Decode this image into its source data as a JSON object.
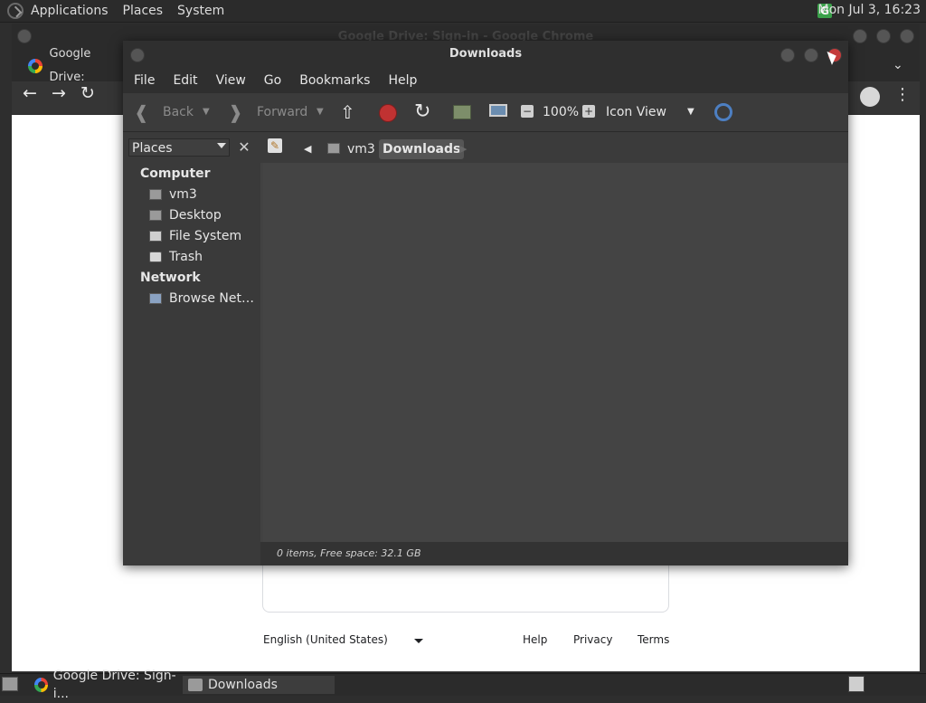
{
  "top_panel": {
    "menus": [
      "Applications",
      "Places",
      "System"
    ],
    "clock": "Mon Jul  3, 16:23"
  },
  "chrome": {
    "title": "Google Drive: Sign-in - Google Chrome",
    "tab_label": "Google Drive:",
    "page": {
      "language": "English (United States)",
      "links": [
        "Help",
        "Privacy",
        "Terms"
      ]
    }
  },
  "file_manager": {
    "title": "Downloads",
    "menu": [
      "File",
      "Edit",
      "View",
      "Go",
      "Bookmarks",
      "Help"
    ],
    "toolbar": {
      "back": "Back",
      "forward": "Forward",
      "zoom": "100%",
      "view_mode": "Icon View"
    },
    "sidebar": {
      "combo": "Places",
      "sections": [
        {
          "heading": "Computer",
          "items": [
            "vm3",
            "Desktop",
            "File System",
            "Trash"
          ]
        },
        {
          "heading": "Network",
          "items": [
            "Browse Net…"
          ]
        }
      ]
    },
    "pathbar": {
      "home": "vm3",
      "current": "Downloads"
    },
    "status": "0 items, Free space: 32.1 GB"
  },
  "taskbar": {
    "tasks": [
      "Google Drive: Sign-i...",
      "Downloads"
    ]
  }
}
